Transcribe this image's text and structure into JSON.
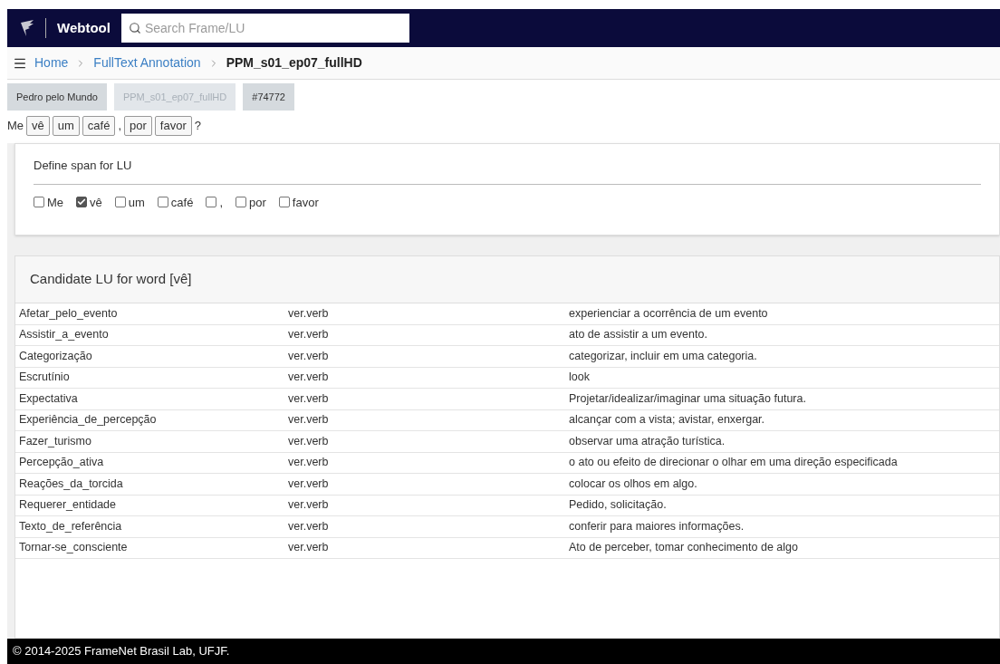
{
  "header": {
    "brand": "Webtool",
    "search": {
      "placeholder": "Search Frame/LU"
    }
  },
  "breadcrumb": [
    {
      "label": "Home",
      "current": false
    },
    {
      "label": "FullText Annotation",
      "current": false
    },
    {
      "label": "PPM_s01_ep07_fullHD",
      "current": true
    }
  ],
  "chips": [
    {
      "label": "Pedro pelo Mundo",
      "disabled": false
    },
    {
      "label": "PPM_s01_ep07_fullHD",
      "disabled": true
    },
    {
      "label": "#74772",
      "disabled": false
    }
  ],
  "sentence": [
    {
      "text": "Me",
      "kind": "plain"
    },
    {
      "text": "vê",
      "kind": "button"
    },
    {
      "text": "um",
      "kind": "button"
    },
    {
      "text": "café",
      "kind": "button"
    },
    {
      "text": ",",
      "kind": "plain"
    },
    {
      "text": "por",
      "kind": "button"
    },
    {
      "text": "favor",
      "kind": "button"
    },
    {
      "text": "?",
      "kind": "plain"
    }
  ],
  "span_panel": {
    "title": "Define span for LU",
    "options": [
      {
        "label": "Me",
        "checked": false
      },
      {
        "label": "vê",
        "checked": true
      },
      {
        "label": "um",
        "checked": false
      },
      {
        "label": "café",
        "checked": false
      },
      {
        "label": ",",
        "checked": false
      },
      {
        "label": "por",
        "checked": false
      },
      {
        "label": "favor",
        "checked": false
      }
    ]
  },
  "candidates": {
    "title": "Candidate LU for word [vê]",
    "rows": [
      [
        "Afetar_pelo_evento",
        "ver.verb",
        "experienciar a ocorrência de um evento"
      ],
      [
        "Assistir_a_evento",
        "ver.verb",
        "ato de assistir a um evento."
      ],
      [
        "Categorização",
        "ver.verb",
        "categorizar, incluir em uma categoria."
      ],
      [
        "Escrutínio",
        "ver.verb",
        "look"
      ],
      [
        "Expectativa",
        "ver.verb",
        "Projetar/idealizar/imaginar uma situação futura."
      ],
      [
        "Experiência_de_percepção",
        "ver.verb",
        "alcançar com a vista; avistar, enxergar."
      ],
      [
        "Fazer_turismo",
        "ver.verb",
        "observar uma atração turística."
      ],
      [
        "Percepção_ativa",
        "ver.verb",
        "o ato ou efeito de direcionar o olhar em uma direção especificada"
      ],
      [
        "Reações_da_torcida",
        "ver.verb",
        "colocar os olhos em algo."
      ],
      [
        "Requerer_entidade",
        "ver.verb",
        "Pedido, solicitação."
      ],
      [
        "Texto_de_referência",
        "ver.verb",
        "conferir para maiores informações."
      ],
      [
        "Tornar-se_consciente",
        "ver.verb",
        "Ato de perceber, tomar conhecimento de algo"
      ]
    ]
  },
  "footer": "© 2014-2025 FrameNet Brasil Lab, UFJF."
}
